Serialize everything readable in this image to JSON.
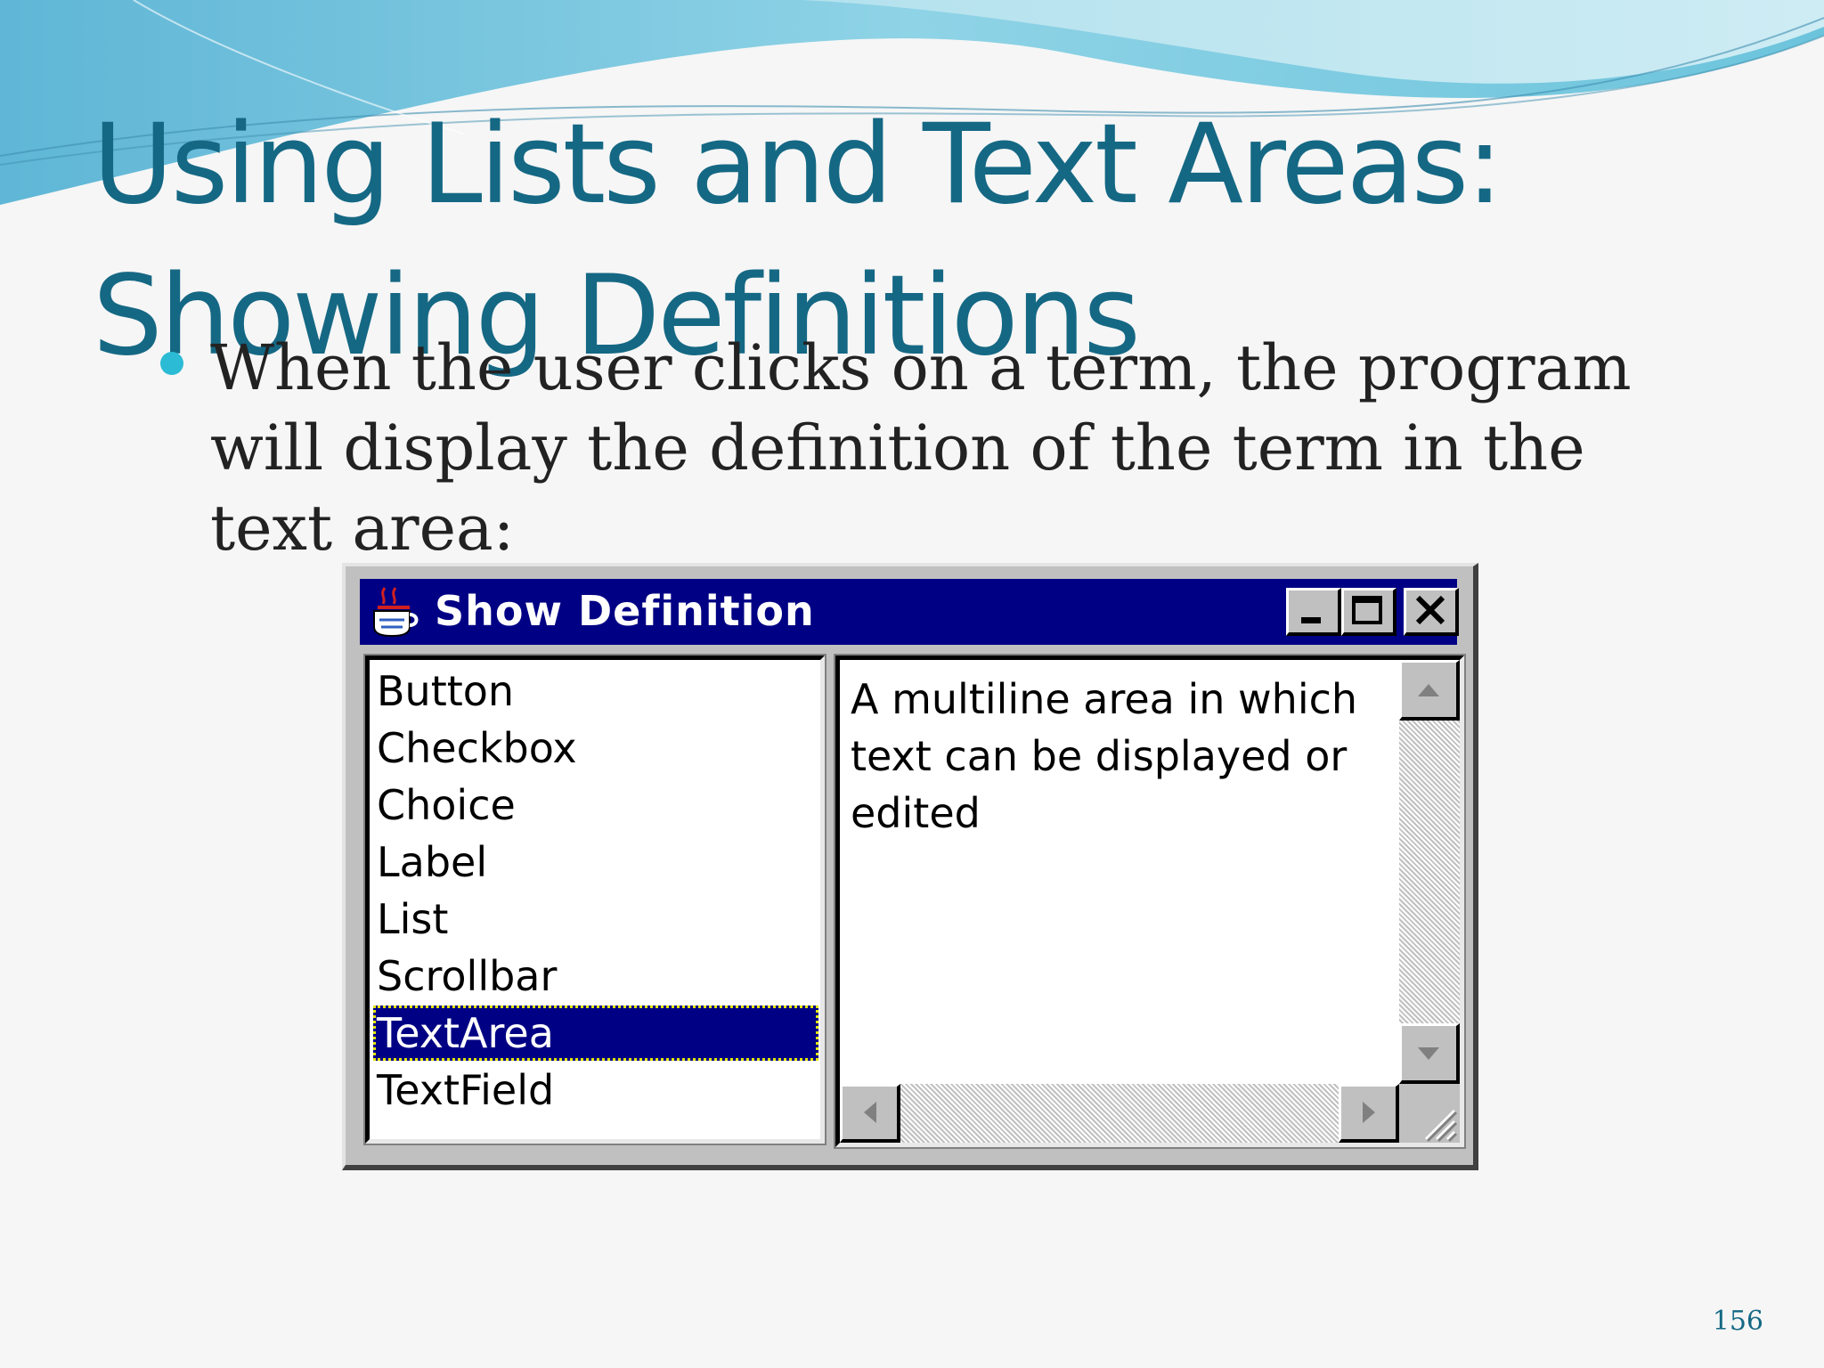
{
  "slide": {
    "title_lines": [
      "Using Lists and Text Areas:",
      "Showing Definitions"
    ],
    "bullet_text": "When the user clicks on a term, the program will display the definition of the term in the text area:",
    "page_number": "156"
  },
  "window": {
    "title": "Show Definition",
    "title_buttons": [
      "minimize-icon",
      "maximize-icon",
      "close-icon"
    ],
    "list_items": [
      "Button",
      "Checkbox",
      "Choice",
      "Label",
      "List",
      "Scrollbar",
      "TextArea",
      "TextField"
    ],
    "selected_item": "TextArea",
    "text_area_lines": [
      "A multiline area in which",
      "text can be displayed or",
      "edited"
    ]
  },
  "colors": {
    "title_text": "#156884",
    "bullet_dot": "#2bbbd4",
    "window_titlebar": "#000084",
    "window_face": "#c0c0c0",
    "selection": "#000084"
  }
}
